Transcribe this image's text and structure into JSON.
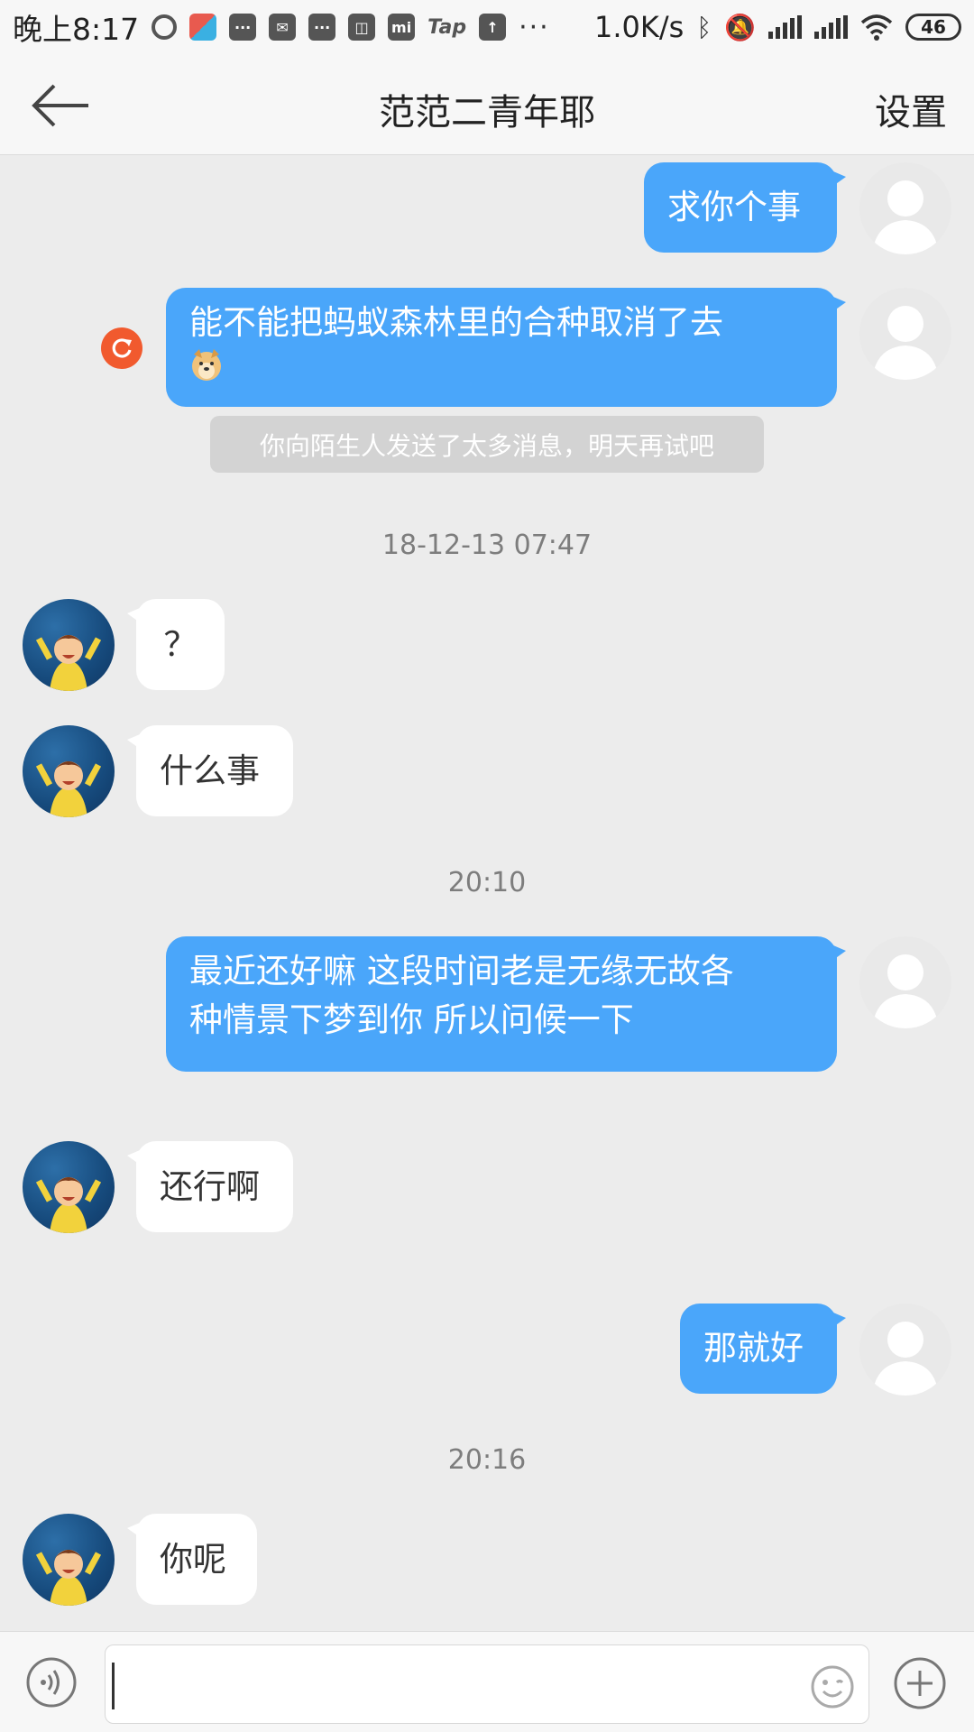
{
  "status_bar": {
    "time": "晚上8:17",
    "tap_label": "Tap",
    "more": "···",
    "net_speed": "1.0K/s",
    "battery": "46"
  },
  "header": {
    "title": "范范二青年耶",
    "settings_label": "设置",
    "back_icon": "arrow-left-icon"
  },
  "colors": {
    "outgoing_bubble": "#4aa6fa",
    "incoming_bubble": "#ffffff",
    "background": "#ececec",
    "resend": "#f15a2e"
  },
  "messages": [
    {
      "from": "me",
      "text": "求你个事"
    },
    {
      "from": "me",
      "line1": "能不能把蚂蚁森林里的合种取消了去",
      "emoji": "doge-emoji",
      "failed": true
    },
    {
      "notice": "你向陌生人发送了太多消息，明天再试吧"
    },
    {
      "timestamp": "18-12-13 07:47"
    },
    {
      "from": "friend",
      "text": "？"
    },
    {
      "from": "friend",
      "text": "什么事"
    },
    {
      "timestamp": "20:10"
    },
    {
      "from": "me",
      "line1": "最近还好嘛  这段时间老是无缘无故各",
      "line2": "种情景下梦到你  所以问候一下"
    },
    {
      "from": "friend",
      "text": "还行啊"
    },
    {
      "from": "me",
      "text": "那就好"
    },
    {
      "timestamp": "20:16"
    },
    {
      "from": "friend",
      "text": "你呢"
    }
  ],
  "input_bar": {
    "voice_icon": "voice-icon",
    "emoji_icon": "smiley-icon",
    "plus_icon": "plus-icon",
    "input_value": ""
  }
}
